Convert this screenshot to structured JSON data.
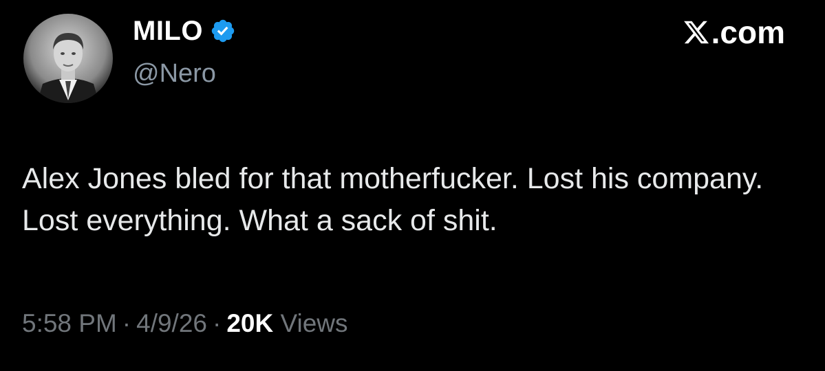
{
  "author": {
    "display_name": "MILO",
    "handle": "@Nero",
    "verified": true,
    "verified_badge_color": "#1d9bf0",
    "avatar_icon": "profile-photo"
  },
  "brand": {
    "logo_icon": "x-logo-icon",
    "domain_text": ".com"
  },
  "tweet": {
    "text": "Alex Jones bled for that motherfucker. Lost his company. Lost everything. What a sack of shit.",
    "time": "5:58 PM",
    "date": "4/9/26",
    "separator": "·",
    "views_count": "20K",
    "views_label": "Views"
  },
  "colors": {
    "background": "#000000",
    "primary_text": "#e7e9ea",
    "secondary_text": "#71767b",
    "handle_text": "#8b98a5"
  }
}
